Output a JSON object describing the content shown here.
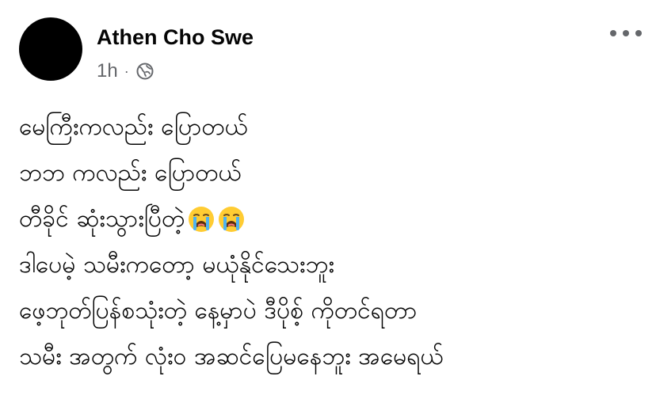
{
  "post": {
    "author": "Athen Cho Swe",
    "time": "1h",
    "separator": "·",
    "audience_icon": "globe-icon",
    "menu_icon": "more-horizontal-icon",
    "lines": [
      "မေကြီးကလည်း ပြောတယ်",
      "ဘဘ ကလည်း ပြောတယ်",
      "တီခိုင် ဆုံးသွားပြီတဲ့",
      "ဒါပေမဲ့ သမီးကတော့ မယုံနိုင်သေးဘူး",
      "ဖေ့ဘုတ်ပြန်စသုံးတဲ့ နေ့မှာပဲ ဒီပိုစ့် ကိုတင်ရတာ",
      "သမီး အတွက် လုံး၀ အဆင်ပြေမနေဘူး အမေရယ်"
    ],
    "line3_emoji": [
      "loudly-crying-face",
      "loudly-crying-face"
    ]
  }
}
